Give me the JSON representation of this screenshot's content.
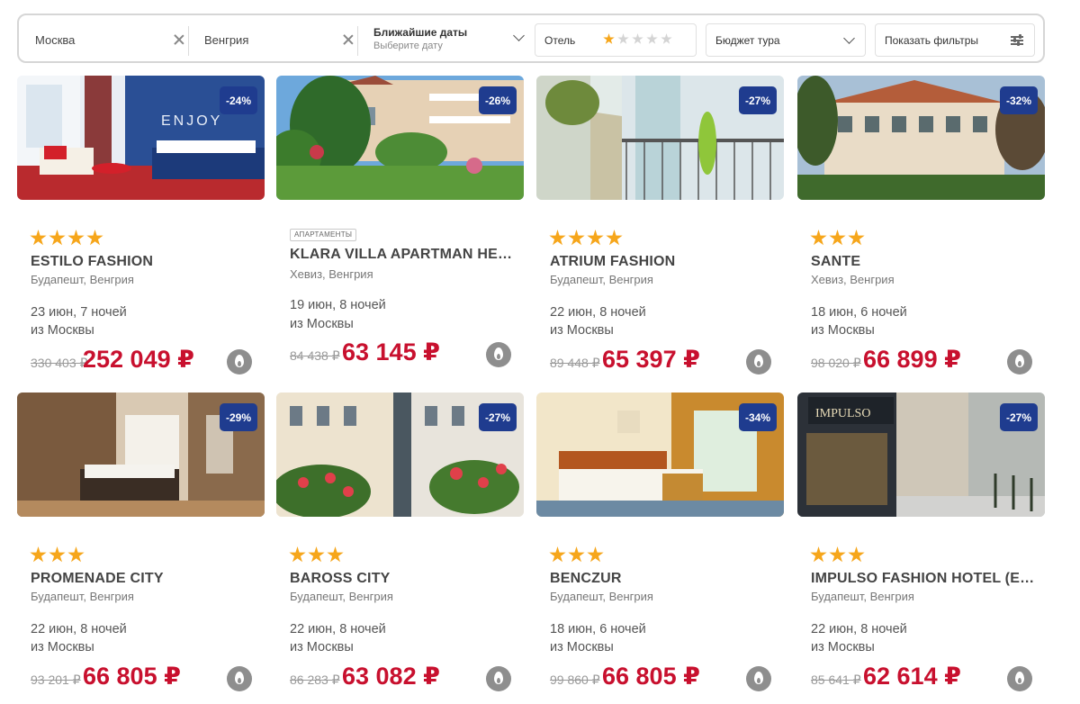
{
  "filters": {
    "from": "Москва",
    "to": "Венгрия",
    "dates_title": "Ближайшие даты",
    "dates_placeholder": "Выберите дату",
    "hotel_label": "Отель",
    "hotel_stars": 1,
    "budget_label": "Бюджет тура",
    "show_filters_label": "Показать фильтры"
  },
  "colors": {
    "discount_badge": "#1f3c8f",
    "price": "#c8102e",
    "star": "#f6a61b"
  },
  "cards": [
    {
      "discount": "-24%",
      "stars": 4,
      "tag": "",
      "name": "ESTILO FASHION",
      "location": "Будапешт, Венгрия",
      "dates": "23 июн, 7 ночей",
      "origin": "из Москвы",
      "old_price": "330 403 ₽",
      "price": "252 049 ₽",
      "hot_icon": "fire-icon"
    },
    {
      "discount": "-26%",
      "stars": 0,
      "tag": "АПАРТАМЕНТЫ",
      "name": "KLARA VILLA APARTMAN HEV...",
      "location": "Хевиз, Венгрия",
      "dates": "19 июн, 8 ночей",
      "origin": "из Москвы",
      "old_price": "84 438 ₽",
      "price": "63 145 ₽",
      "hot_icon": "fire-icon"
    },
    {
      "discount": "-27%",
      "stars": 4,
      "tag": "",
      "name": "ATRIUM FASHION",
      "location": "Будапешт, Венгрия",
      "dates": "22 июн, 8 ночей",
      "origin": "из Москвы",
      "old_price": "89 448 ₽",
      "price": "65 397 ₽",
      "hot_icon": "fire-icon"
    },
    {
      "discount": "-32%",
      "stars": 3,
      "tag": "",
      "name": "SANTE",
      "location": "Хевиз, Венгрия",
      "dates": "18 июн, 6 ночей",
      "origin": "из Москвы",
      "old_price": "98 020 ₽",
      "price": "66 899 ₽",
      "hot_icon": "fire-icon"
    },
    {
      "discount": "-29%",
      "stars": 3,
      "tag": "",
      "name": "PROMENADE CITY",
      "location": "Будапешт, Венгрия",
      "dates": "22 июн, 8 ночей",
      "origin": "из Москвы",
      "old_price": "93 201 ₽",
      "price": "66 805 ₽",
      "hot_icon": "fire-icon"
    },
    {
      "discount": "-27%",
      "stars": 3,
      "tag": "",
      "name": "BAROSS CITY",
      "location": "Будапешт, Венгрия",
      "dates": "22 июн, 8 ночей",
      "origin": "из Москвы",
      "old_price": "86 283 ₽",
      "price": "63 082 ₽",
      "hot_icon": "fire-icon"
    },
    {
      "discount": "-34%",
      "stars": 3,
      "tag": "",
      "name": "BENCZUR",
      "location": "Будапешт, Венгрия",
      "dates": "18 июн, 6 ночей",
      "origin": "из Москвы",
      "old_price": "99 860 ₽",
      "price": "66 805 ₽",
      "hot_icon": "fire-icon"
    },
    {
      "discount": "-27%",
      "stars": 3,
      "tag": "",
      "name": "IMPULSO FASHION HOTEL (EX...",
      "location": "Будапешт, Венгрия",
      "dates": "22 июн, 8 ночей",
      "origin": "из Москвы",
      "old_price": "85 641 ₽",
      "price": "62 614 ₽",
      "hot_icon": "fire-icon"
    }
  ]
}
